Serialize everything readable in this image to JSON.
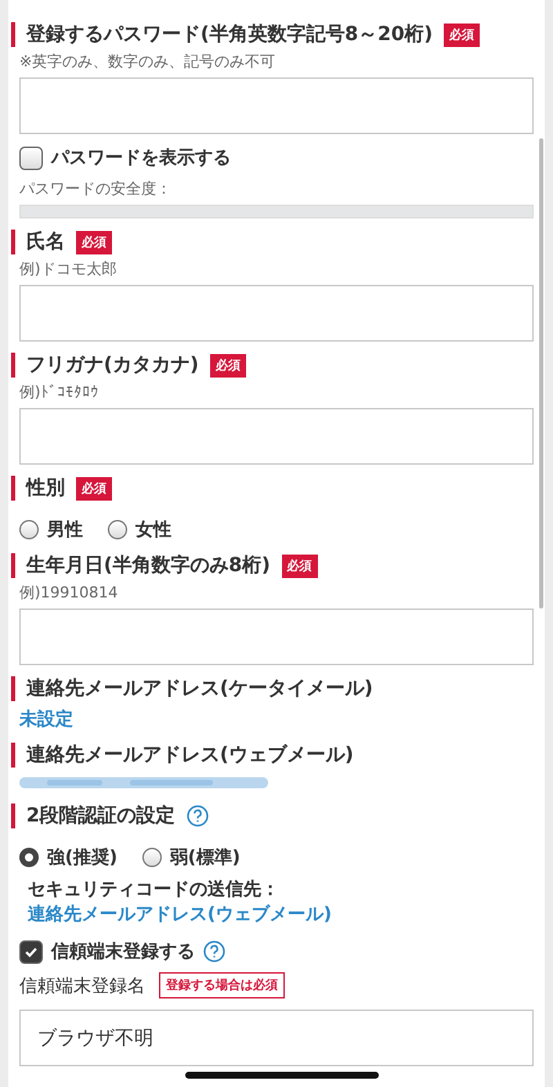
{
  "blocks": [
    {
      "kind": "heading",
      "title": "登録するパスワード(半角英数字記号8～20桁)",
      "badge": {
        "text": "必須",
        "kind": "solid"
      }
    },
    {
      "kind": "hint",
      "text": "※英字のみ、数字のみ、記号のみ不可"
    },
    {
      "kind": "input"
    },
    {
      "kind": "checkbox",
      "label": "パスワードを表示する",
      "checked": false
    },
    {
      "kind": "meter",
      "label": "パスワードの安全度：",
      "level": 0
    },
    {
      "kind": "heading",
      "title": "氏名",
      "badge": {
        "text": "必須",
        "kind": "solid"
      }
    },
    {
      "kind": "hint",
      "text": "例)ドコモ太郎"
    },
    {
      "kind": "input"
    },
    {
      "kind": "heading",
      "title": "フリガナ(カタカナ)",
      "badge": {
        "text": "必須",
        "kind": "solid"
      }
    },
    {
      "kind": "hint",
      "text": "例)ﾄﾞｺﾓﾀﾛｳ"
    },
    {
      "kind": "input"
    },
    {
      "kind": "heading",
      "title": "性別",
      "badge": {
        "text": "必須",
        "kind": "solid"
      }
    },
    {
      "kind": "radios",
      "options": [
        {
          "label": "男性",
          "selected": false
        },
        {
          "label": "女性",
          "selected": false
        }
      ]
    },
    {
      "kind": "heading",
      "title": "生年月日(半角数字のみ8桁)",
      "badge": {
        "text": "必須",
        "kind": "solid"
      }
    },
    {
      "kind": "hint",
      "text": "例)19910814"
    },
    {
      "kind": "input"
    },
    {
      "kind": "heading",
      "title": "連絡先メールアドレス(ケータイメール)"
    },
    {
      "kind": "link",
      "text": "未設定"
    },
    {
      "kind": "heading",
      "title": "連絡先メールアドレス(ウェブメール)"
    },
    {
      "kind": "redacted"
    },
    {
      "kind": "heading",
      "title": "2段階認証の設定",
      "help": true
    },
    {
      "kind": "radios",
      "options": [
        {
          "label": "強(推奨)",
          "selected": true
        },
        {
          "label": "弱(標準)",
          "selected": false
        }
      ]
    },
    {
      "kind": "sendto",
      "label": "セキュリティコードの送信先：",
      "link": "連絡先メールアドレス(ウェブメール)"
    },
    {
      "kind": "checkbox",
      "label": "信頼端末登録する",
      "checked": true,
      "help": true
    },
    {
      "kind": "label",
      "text": "信頼端末登録名",
      "badge": {
        "text": "登録する場合は必須",
        "kind": "outline"
      }
    },
    {
      "kind": "input",
      "value": "ブラウザ不明"
    }
  ]
}
